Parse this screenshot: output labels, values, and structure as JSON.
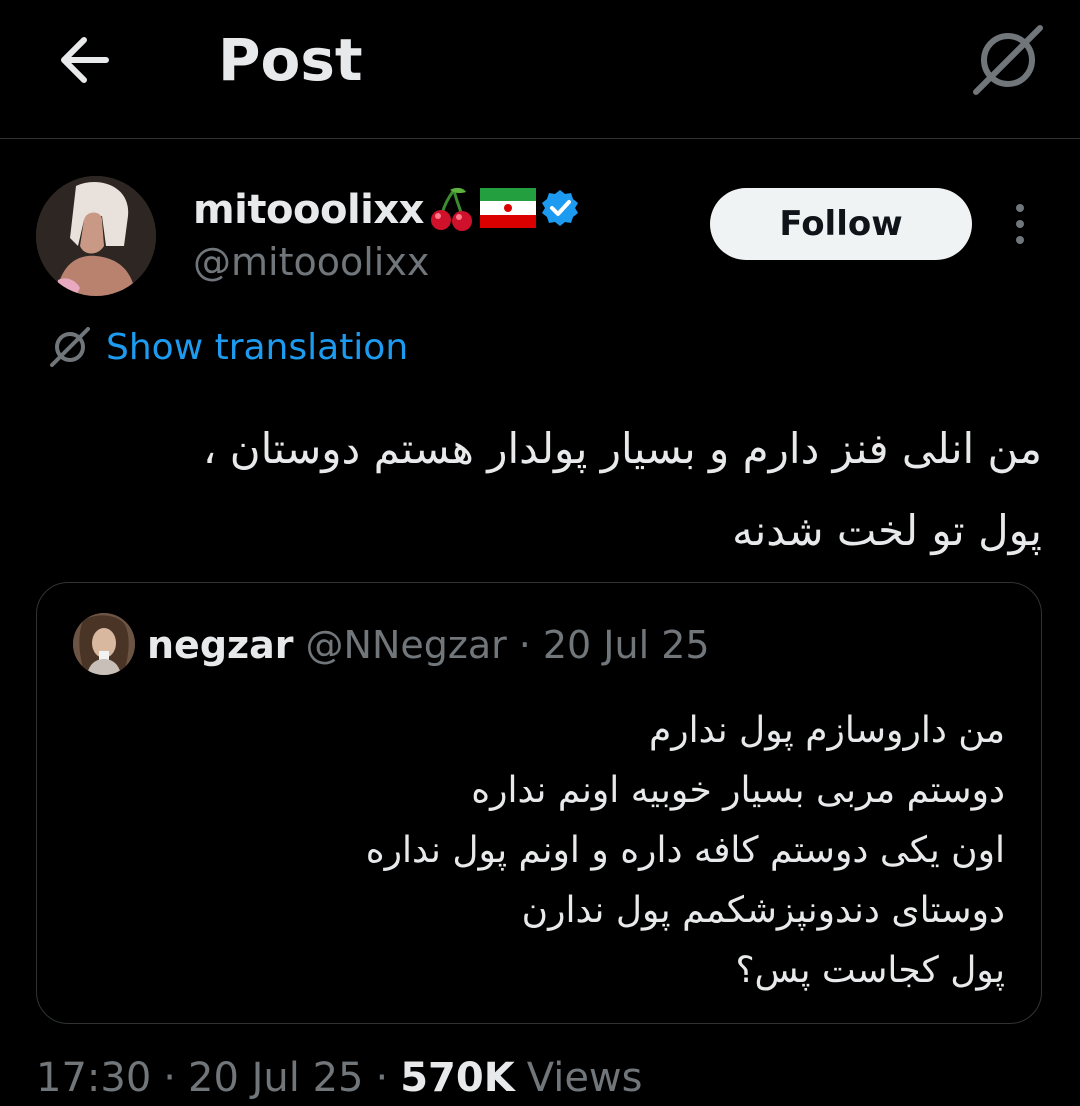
{
  "header": {
    "title": "Post",
    "back_icon": "arrow-left-icon",
    "translate_icon": "translate-icon"
  },
  "author": {
    "display_name": "mitooolixx",
    "name_emojis": [
      "cherries",
      "flag-iran"
    ],
    "verified": true,
    "handle": "@mitooolixx",
    "follow_label": "Follow",
    "more_icon": "more-vertical-icon"
  },
  "translation": {
    "label": "Show translation",
    "icon": "translate-icon"
  },
  "post": {
    "text_lines": [
      "من انلی فنز دارم و بسیار پولدار هستم دوستان ،",
      "پول تو لخت شدنه"
    ]
  },
  "quote": {
    "name": "negzar",
    "handle": "@NNegzar",
    "separator": "·",
    "date": "20 Jul 25",
    "text_lines": [
      "من داروسازم پول ندارم",
      "دوستم مربی بسیار خوبیه اونم نداره",
      "اون یکی دوستم کافه داره و اونم پول نداره",
      "دوستای دندونپزشکمم پول ندارن",
      "پول کجاست پس؟"
    ]
  },
  "stats": {
    "time": "17:30",
    "sep1": "·",
    "date": "20 Jul 25",
    "sep2": "·",
    "views_count": "570K",
    "views_label": "Views"
  },
  "colors": {
    "background": "#000000",
    "text_primary": "#e7e9ea",
    "text_secondary": "#71767b",
    "link": "#1d9bf0",
    "border": "#2f3336",
    "verified": "#1d9bf0",
    "follow_bg": "#eff3f4"
  }
}
